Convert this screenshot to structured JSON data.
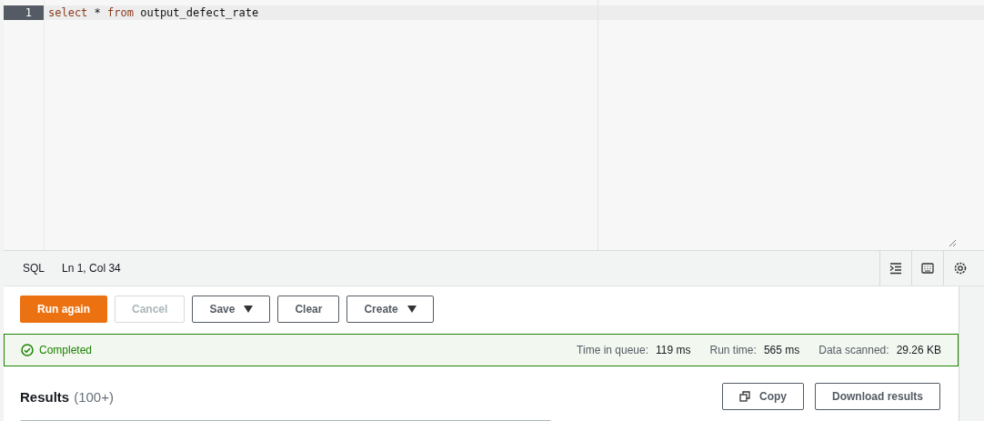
{
  "editor": {
    "lines": [
      {
        "number": "1",
        "code": [
          {
            "kind": "keyword",
            "text": "select"
          },
          {
            "kind": "plain",
            "text": "*"
          },
          {
            "kind": "keyword",
            "text": "from"
          },
          {
            "kind": "plain",
            "text": "output_defect_rate"
          }
        ],
        "selected": true
      }
    ]
  },
  "status_bar": {
    "language": "SQL",
    "position": "Ln 1, Col 34"
  },
  "actions": [
    {
      "label": "Run again",
      "kind": "primary",
      "disabled": false,
      "dropdown": false
    },
    {
      "label": "Cancel",
      "kind": "normal",
      "disabled": true,
      "dropdown": false
    },
    {
      "label": "Save",
      "kind": "normal",
      "disabled": false,
      "dropdown": true
    },
    {
      "label": "Clear",
      "kind": "normal",
      "disabled": false,
      "dropdown": false
    },
    {
      "label": "Create",
      "kind": "normal",
      "disabled": false,
      "dropdown": true
    }
  ],
  "query_status": {
    "state": "Completed",
    "stats": [
      {
        "label": "Time in queue:",
        "value": "119 ms"
      },
      {
        "label": "Run time:",
        "value": "565 ms"
      },
      {
        "label": "Data scanned:",
        "value": "29.26 KB"
      }
    ]
  },
  "results": {
    "title": "Results",
    "count": "(100+)",
    "buttons": [
      {
        "label": "Copy",
        "kind": "copy"
      },
      {
        "label": "Download results",
        "kind": "plain"
      }
    ]
  }
}
